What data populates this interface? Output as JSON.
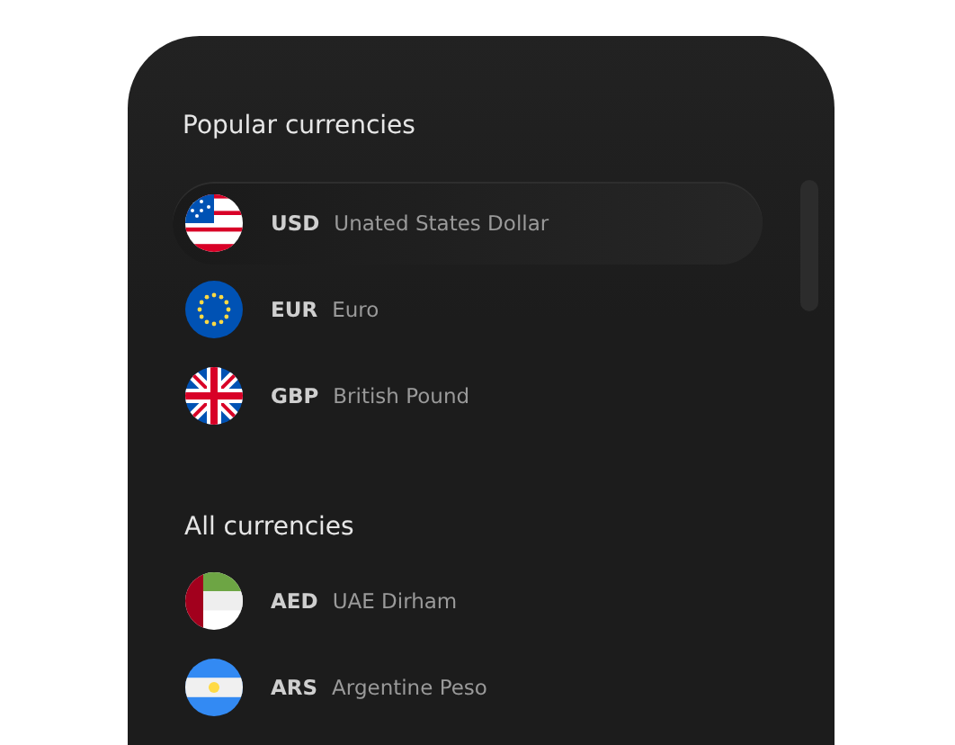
{
  "sections": [
    {
      "title": "Popular currencies",
      "items": [
        {
          "kind": "us",
          "code": "USD",
          "name": "Unated States Dollar",
          "selected": true
        },
        {
          "kind": "eu",
          "code": "EUR",
          "name": "Euro",
          "selected": false
        },
        {
          "kind": "gb",
          "code": "GBP",
          "name": "British Pound",
          "selected": false
        }
      ]
    },
    {
      "title": "All currencies",
      "items": [
        {
          "kind": "ae",
          "code": "AED",
          "name": "UAE Dirham",
          "selected": false
        },
        {
          "kind": "ar",
          "code": "ARS",
          "name": "Argentine Peso",
          "selected": false
        }
      ]
    }
  ]
}
